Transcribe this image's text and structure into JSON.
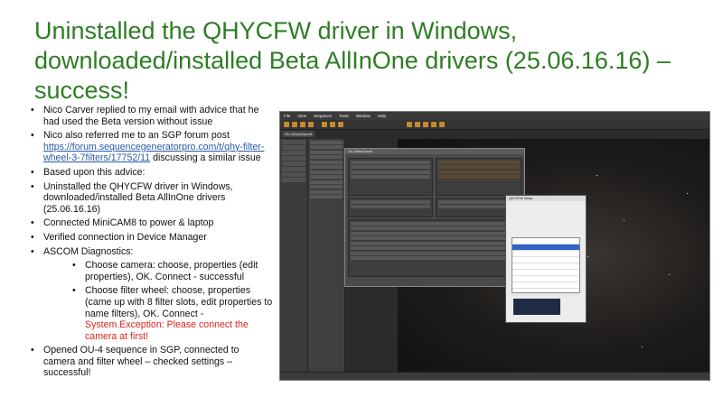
{
  "slide": {
    "title": "Uninstalled the QHYCFW driver in Windows, downloaded/installed Beta AllInOne drivers (25.06.16.16) – success!",
    "bullets": [
      "Nico Carver replied to my email with advice that he had used the Beta version without issue",
      "Nico also referred me to an SGP forum post",
      "https://forum.sequencegeneratorpro.com/t/qhy-filter-wheel-3-7filters/17752/11",
      "discussing a similar issue",
      "Based upon this advice:",
      "Uninstalled the QHYCFW driver in Windows, downloaded/installed Beta AllInOne drivers (25.06.16.16)",
      "Connected MiniCAM8 to power & laptop",
      "Verified connection in Device Manager",
      "ASCOM Diagnostics:",
      "Choose camera: choose, properties (edit properties), OK.  Connect - successful",
      "Choose filter wheel: choose, properties (came up with 8 filter slots, edit properties to name filters), OK.  Connect -",
      "System.Exception: Please connect the camera at first!",
      "Opened OU-4 sequence in SGP, connected to camera and filter wheel – checked settings – successful!"
    ]
  },
  "screenshot": {
    "menu": [
      "File",
      "View",
      "Sequence",
      "Tools",
      "Window",
      "Help"
    ],
    "tab": "OU-4GainOpenA",
    "dialog_title": "QHYCFW Setup"
  }
}
